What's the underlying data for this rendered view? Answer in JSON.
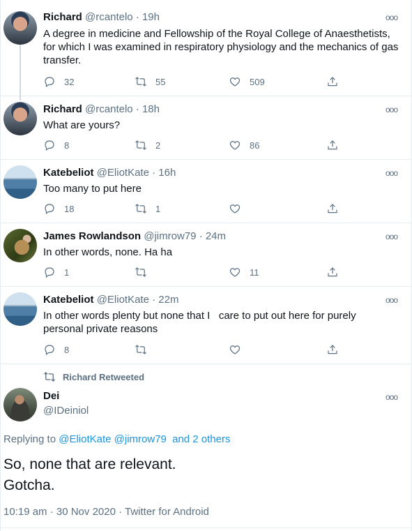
{
  "tweets": [
    {
      "name": "Richard",
      "handle": "@rcantelo",
      "time": "19h",
      "text": "A degree in medicine and Fellowship of the Royal College of Anaesthetists, for which I was examined in respiratory physiology and the mechanics of gas transfer.",
      "replies": "32",
      "retweets": "55",
      "likes": "509"
    },
    {
      "name": "Richard",
      "handle": "@rcantelo",
      "time": "18h",
      "text": "What are yours?",
      "replies": "8",
      "retweets": "2",
      "likes": "86"
    },
    {
      "name": "Katebeliot",
      "handle": "@EliotKate",
      "time": "16h",
      "text": "Too many to put here",
      "replies": "18",
      "retweets": "1",
      "likes": ""
    },
    {
      "name": "James Rowlandson",
      "handle": "@jimrow79",
      "time": "24m",
      "text": "In other words, none. Ha ha",
      "replies": "1",
      "retweets": "",
      "likes": "11"
    },
    {
      "name": "Katebeliot",
      "handle": "@EliotKate",
      "time": "22m",
      "text": "In other words plenty but none that I   care to put out here for purely personal private reasons",
      "replies": "8",
      "retweets": "",
      "likes": ""
    }
  ],
  "separator": "·",
  "more_glyph": "ooo",
  "retweet_banner": "Richard Retweeted",
  "main_tweet": {
    "name": "Dei",
    "handle": "@IDeiniol",
    "replying_prefix": "Replying to",
    "replying_to_1": "@EliotKate",
    "replying_to_2": "@jimrow79",
    "replying_others": "and 2 others",
    "line1": "So, none that are relevant.",
    "line2": "Gotcha.",
    "timestamp": "10:19 am · 30 Nov 2020 · Twitter for Android"
  },
  "icons": {
    "reply": "reply-icon",
    "retweet": "retweet-icon",
    "like": "heart-icon",
    "share": "share-icon",
    "more": "more-icon"
  },
  "colors": {
    "link": "#1b95e0",
    "muted": "#5b7083",
    "text": "#0f1419"
  }
}
